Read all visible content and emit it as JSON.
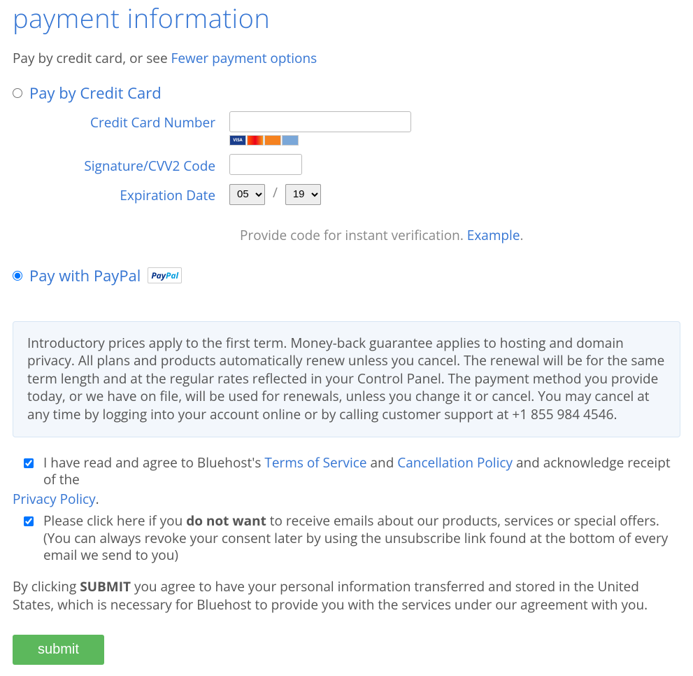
{
  "heading": "payment information",
  "intro": {
    "prefix": "Pay by credit card, or see ",
    "link": "Fewer payment options"
  },
  "methods": {
    "credit_card": {
      "label": "Pay by Credit Card",
      "selected": false,
      "fields": {
        "card_number_label": "Credit Card Number",
        "card_number_value": "",
        "cvv_label": "Signature/CVV2 Code",
        "cvv_value": "",
        "exp_label": "Expiration Date",
        "exp_month": "05",
        "exp_year": "19",
        "separator": "/"
      },
      "card_brands": [
        "VISA",
        "MC",
        "DISCVR",
        "AMEX"
      ],
      "verify_text": "Provide code for instant verification. ",
      "verify_link": "Example",
      "verify_suffix": "."
    },
    "paypal": {
      "label": "Pay with PayPal",
      "badge_pay": "Pay",
      "badge_pal": "Pal",
      "selected": true
    }
  },
  "disclosure": "Introductory prices apply to the first term. Money-back guarantee applies to hosting and domain privacy. All plans and products automatically renew unless you cancel. The renewal will be for the same term length and at the regular rates reflected in your Control Panel. The payment method you provide today, or we have on file, will be used for renewals, unless you change it or cancel. You may cancel at any time by logging into your account online or by calling customer support at +1 855 984 4546.",
  "agreements": {
    "tos": {
      "prefix": " I have read and agree to Bluehost's ",
      "tos_link": "Terms of Service",
      "and": " and ",
      "cancel_link": "Cancellation Policy",
      "suffix": " and acknowledge receipt of the ",
      "privacy_link": "Privacy Policy",
      "period": "."
    },
    "optout": {
      "prefix": " Please click here if you ",
      "bold": "do not want",
      "suffix": " to receive emails about our products, services or special offers.",
      "note": "(You can always revoke your consent later by using the unsubscribe link found at the bottom of every email we send to you)"
    }
  },
  "final": {
    "prefix": "By clicking ",
    "bold": "SUBMIT",
    "suffix": " you agree to have your personal information transferred and stored in the United States, which is necessary for Bluehost to provide you with the services under our agreement with you."
  },
  "submit_label": "submit"
}
